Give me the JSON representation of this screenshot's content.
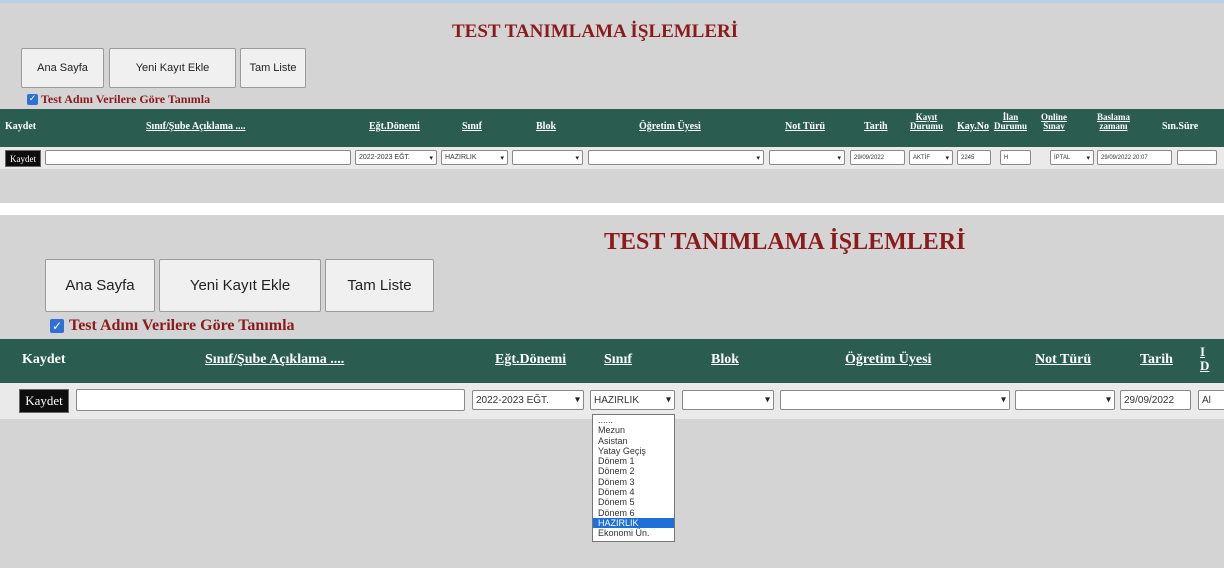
{
  "page_title": "TEST TANIMLAMA İŞLEMLERİ",
  "buttons": {
    "home": "Ana Sayfa",
    "new_record": "Yeni Kayıt Ekle",
    "full_list": "Tam Liste"
  },
  "checkbox": {
    "label": "Test Adını Verilere Göre Tanımla",
    "checked": true
  },
  "columns": {
    "kaydet": "Kaydet",
    "sinif_sube": "Sınıf/Şube Açıklama ....",
    "egt_donemi": "Eğt.Dönemi",
    "sinif": "Sınıf",
    "blok": "Blok",
    "ogretim_uyesi": "Öğretim Üyesi",
    "not_turu": "Not Türü",
    "tarih": "Tarih",
    "kayit_durumu_1": "Kayıt",
    "kayit_durumu_2": "Durumu",
    "kay_no": "Kay.No",
    "ilan_durumu_1": "İlan",
    "ilan_durumu_2": "Durumu",
    "online_sinav_1": "Online",
    "online_sinav_2": "Sınav",
    "baslama_zamani_1": "Baslama",
    "baslama_zamani_2": "zamanı",
    "sin_suresi": "Sın.Süre"
  },
  "row": {
    "kaydet_button": "Kaydet",
    "sinif_sube": "",
    "egt_donemi": "2022-2023 EĞT.",
    "sinif": "HAZIRLIK",
    "blok": "",
    "ogretim_uyesi": "",
    "not_turu": "",
    "tarih": "29/09/2022",
    "kayit_durumu": "AKTİF",
    "kay_no": "2245",
    "ilan_durumu": "H",
    "online_sinav": "İPTAL",
    "baslama_zamani": "29/09/2022 20:07",
    "sin_suresi": ""
  },
  "partial_second": {
    "header_fragment_1": "I",
    "header_fragment_2": "D",
    "field_fragment": "Al"
  },
  "sinif_dropdown_options": [
    "......",
    "Mezun",
    "Asistan",
    "Yatay Geçiş",
    "Dönem 1",
    "Dönem 2",
    "Dönem 3",
    "Dönem 4",
    "Dönem 5",
    "Dönem 6",
    "HAZIRLIK",
    "Ekonomi Ün."
  ],
  "sinif_dropdown_selected": "HAZIRLIK",
  "icons": {
    "checkbox": "checkmark-icon",
    "select": "chevron-down-icon"
  },
  "colors": {
    "title": "#8b1a1a",
    "header_bar": "#2a5c50",
    "panel_bg": "#d4d4d4",
    "checkbox": "#2f6fd6",
    "dropdown_highlight": "#1e6fd9"
  }
}
